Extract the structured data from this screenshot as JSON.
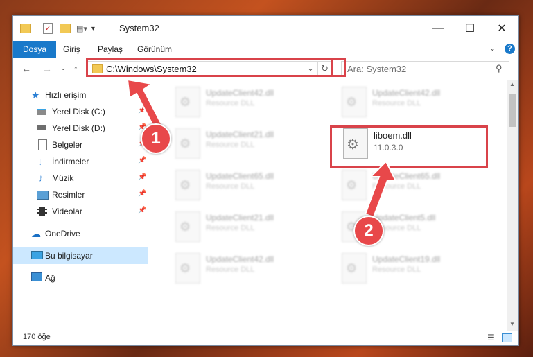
{
  "window": {
    "title": "System32"
  },
  "ribbon": {
    "tabs": [
      "Dosya",
      "Giriş",
      "Paylaş",
      "Görünüm"
    ]
  },
  "address": {
    "path": "C:\\Windows\\System32"
  },
  "search": {
    "placeholder": "Ara: System32"
  },
  "sidebar": {
    "items": [
      {
        "label": "Hızlı erişim"
      },
      {
        "label": "Yerel Disk (C:)"
      },
      {
        "label": "Yerel Disk (D:)"
      },
      {
        "label": "Belgeler"
      },
      {
        "label": "İndirmeler"
      },
      {
        "label": "Müzik"
      },
      {
        "label": "Resimler"
      },
      {
        "label": "Videolar"
      },
      {
        "label": "OneDrive"
      },
      {
        "label": "Bu bilgisayar"
      },
      {
        "label": "Ağ"
      }
    ]
  },
  "files": {
    "blurred": [
      {
        "name": "UpdateClient42.dll",
        "type": "Resource DLL"
      },
      {
        "name": "UpdateClient42.dll",
        "type": "Resource DLL"
      },
      {
        "name": "UpdateClient21.dll",
        "type": "Resource DLL"
      },
      {
        "name": "UpdateClient65.dll",
        "type": "Resource DLL"
      },
      {
        "name": "UpdateClient65.dll",
        "type": "Resource DLL"
      },
      {
        "name": "UpdateClient21.dll",
        "type": "Resource DLL"
      },
      {
        "name": "UpdateClient5.dll",
        "type": "Resource DLL"
      },
      {
        "name": "UpdateClient42.dll",
        "type": "Resource DLL"
      },
      {
        "name": "UpdateClient19.dll",
        "type": "Resource DLL"
      }
    ],
    "highlighted": {
      "name": "liboem.dll",
      "version": "11.0.3.0"
    }
  },
  "status": {
    "count": "170 öğe"
  },
  "annotations": {
    "one": "1",
    "two": "2"
  },
  "colors": {
    "accent": "#1979ca",
    "highlight": "#d9434a"
  }
}
